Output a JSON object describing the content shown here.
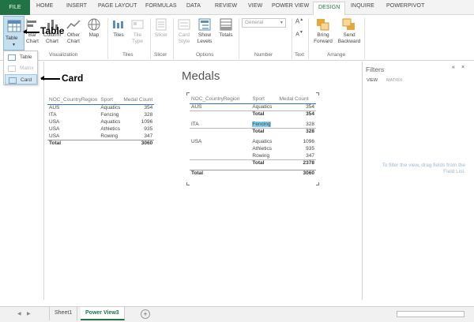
{
  "tabs": {
    "file": "FILE",
    "items": [
      "HOME",
      "INSERT",
      "PAGE LAYOUT",
      "FORMULAS",
      "DATA",
      "REVIEW",
      "VIEW",
      "POWER VIEW",
      "DESIGN",
      "INQUIRE",
      "POWERPIVOT"
    ],
    "active": "DESIGN"
  },
  "ribbon": {
    "table": "Table",
    "bar_chart_1": "Bar",
    "bar_chart_2": "Chart",
    "column_chart_1": "Column",
    "column_chart_2": "Chart",
    "other_chart_1": "Other",
    "other_chart_2": "Chart",
    "map": "Map",
    "tiles": "Tiles",
    "tile_type_1": "Tile",
    "tile_type_2": "Type",
    "slicer": "Slicer",
    "card_style_1": "Card",
    "card_style_2": "Style",
    "show_levels_1": "Show",
    "show_levels_2": "Levels",
    "totals": "Totals",
    "number_format": "General",
    "bring_forward_1": "Bring",
    "bring_forward_2": "Forward",
    "send_backward_1": "Send",
    "send_backward_2": "Backward",
    "groups": {
      "visualization": "Visualization",
      "tiles": "Tiles",
      "slicer": "Slicer",
      "options": "Options",
      "number": "Number",
      "text": "Text",
      "arrange": "Arrange"
    }
  },
  "menu": {
    "items": [
      "Table",
      "Matrix",
      "Card"
    ]
  },
  "callouts": {
    "table": "Table",
    "card": "Card"
  },
  "canvas": {
    "title": "Medals",
    "table1": {
      "headers": [
        "NOC_CountryRegion",
        "Sport",
        "Medal Count"
      ],
      "rows": [
        [
          "AUS",
          "Aquatics",
          "354"
        ],
        [
          "ITA",
          "Fencing",
          "328"
        ],
        [
          "USA",
          "Aquatics",
          "1096"
        ],
        [
          "USA",
          "Athletics",
          "935"
        ],
        [
          "USA",
          "Rowing",
          "347"
        ]
      ],
      "total_label": "Total",
      "total_value": "3060"
    },
    "table2": {
      "headers": [
        "NOC_CountryRegion",
        "Sport",
        "Medal Count"
      ],
      "aus": "AUS",
      "aus_rows": [
        [
          "Aquatics",
          "354"
        ]
      ],
      "aus_total": [
        "Total",
        "354"
      ],
      "ita": "ITA",
      "ita_rows": [
        [
          "Fencing",
          "328"
        ]
      ],
      "ita_total": [
        "Total",
        "328"
      ],
      "usa": "USA",
      "usa_rows": [
        [
          "Aquatics",
          "1096"
        ],
        [
          "Athletics",
          "935"
        ],
        [
          "Rowing",
          "347"
        ]
      ],
      "usa_total": [
        "Total",
        "2378"
      ],
      "grand_total": [
        "Total",
        "3060"
      ]
    }
  },
  "filters": {
    "title": "Filters",
    "view": "VIEW",
    "matrix": "MATRIX",
    "hint": "To filter the view, drag fields from the Field List."
  },
  "sheets": {
    "items": [
      "Sheet1",
      "Power View3"
    ],
    "active": "Power View3"
  }
}
